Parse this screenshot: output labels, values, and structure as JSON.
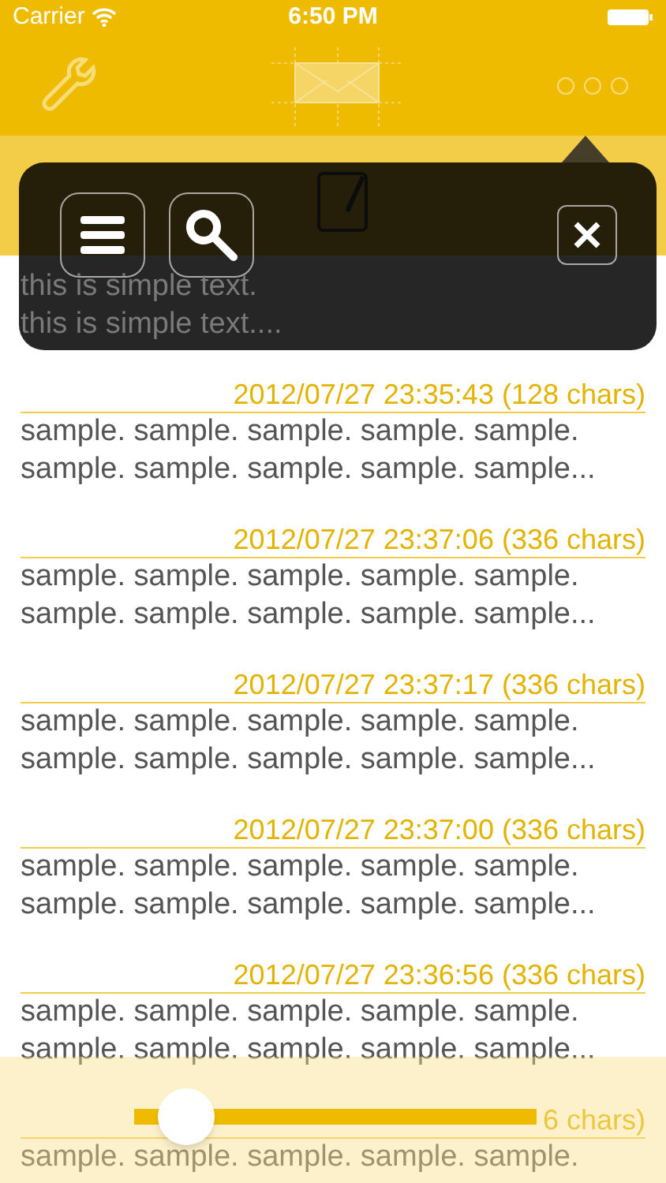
{
  "status_bar": {
    "carrier": "Carrier",
    "time": "6:50 PM"
  },
  "popover": {
    "buttons": [
      {
        "kind": "menu"
      },
      {
        "kind": "search"
      }
    ]
  },
  "first_note": {
    "lines": [
      "this is simple text.",
      "this is simple text...."
    ]
  },
  "notes": [
    {
      "header": "2012/07/27 23:35:43 (128 chars)",
      "lines": [
        "sample. sample. sample. sample. sample.",
        "sample. sample. sample. sample. sample..."
      ]
    },
    {
      "header": "2012/07/27 23:37:06 (336 chars)",
      "lines": [
        "sample. sample. sample. sample. sample.",
        "sample. sample. sample. sample. sample..."
      ]
    },
    {
      "header": "2012/07/27 23:37:17 (336 chars)",
      "lines": [
        "sample. sample. sample. sample. sample.",
        "sample. sample. sample. sample. sample..."
      ]
    },
    {
      "header": "2012/07/27 23:37:00 (336 chars)",
      "lines": [
        "sample. sample. sample. sample. sample.",
        "sample. sample. sample. sample. sample..."
      ]
    },
    {
      "header": "2012/07/27 23:36:56 (336 chars)",
      "lines": [
        "sample. sample. sample. sample. sample.",
        "sample. sample. sample. sample. sample..."
      ]
    },
    {
      "header": "6 chars)",
      "lines": [
        "sample. sample. sample. sample. sample."
      ]
    }
  ],
  "slider": {
    "level": 0.06
  }
}
